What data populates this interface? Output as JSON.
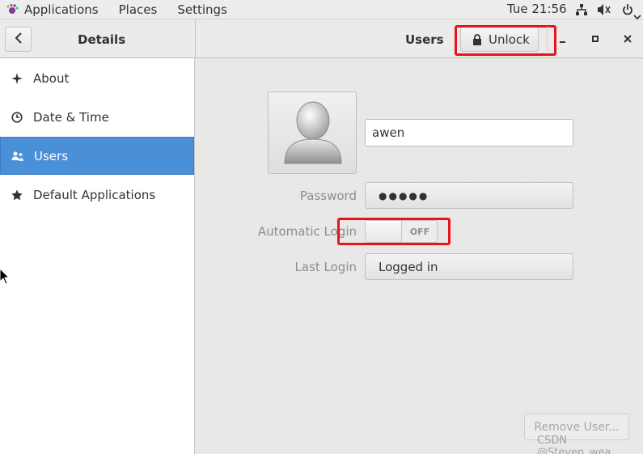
{
  "topbar": {
    "menus": [
      "Applications",
      "Places",
      "Settings"
    ],
    "clock": "Tue 21:56"
  },
  "header": {
    "sidebar_title": "Details",
    "page_title": "Users",
    "unlock_label": "Unlock"
  },
  "sidebar": {
    "items": [
      {
        "label": "About",
        "icon": "sparkle-icon"
      },
      {
        "label": "Date & Time",
        "icon": "clock-icon"
      },
      {
        "label": "Users",
        "icon": "users-icon",
        "active": true
      },
      {
        "label": "Default Applications",
        "icon": "star-icon"
      }
    ]
  },
  "user": {
    "name": "awen",
    "password_label": "Password",
    "password_value": "●●●●●",
    "autologin_label": "Automatic Login",
    "autologin_state": "OFF",
    "lastlogin_label": "Last Login",
    "lastlogin_value": "Logged in"
  },
  "footer": {
    "remove_label": "Remove User...",
    "watermark": "CSDN @Steven_wea"
  },
  "colors": {
    "accent": "#4a90d9",
    "highlight": "#e8131b"
  }
}
